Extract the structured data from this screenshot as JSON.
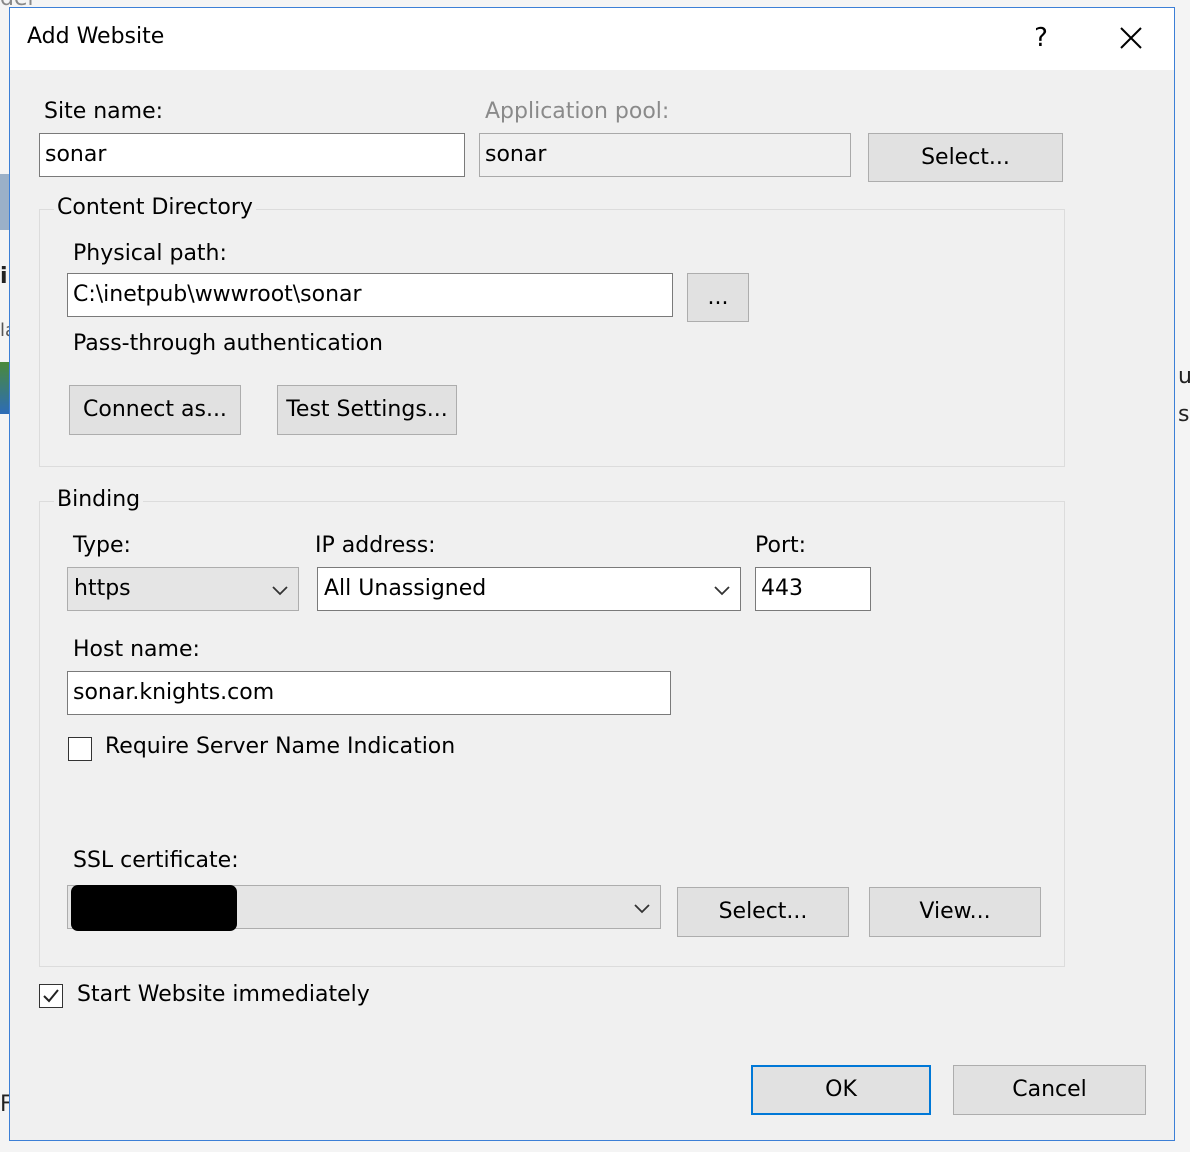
{
  "background": {
    "fragments": [
      "der",
      "il",
      "la",
      "u",
      "s",
      "F"
    ]
  },
  "dialog": {
    "title": "Add Website",
    "help_icon": "?",
    "close_icon": "close-icon"
  },
  "site": {
    "site_name_label": "Site name:",
    "site_name_value": "sonar",
    "app_pool_label": "Application pool:",
    "app_pool_value": "sonar",
    "select_button": "Select..."
  },
  "content_directory": {
    "title": "Content Directory",
    "physical_path_label": "Physical path:",
    "physical_path_value": "C:\\inetpub\\wwwroot\\sonar",
    "browse_button": "...",
    "pass_through_label": "Pass-through authentication",
    "connect_as_button": "Connect as...",
    "test_settings_button": "Test Settings..."
  },
  "binding": {
    "title": "Binding",
    "type_label": "Type:",
    "type_value": "https",
    "ip_label": "IP address:",
    "ip_value": "All Unassigned",
    "port_label": "Port:",
    "port_value": "443",
    "host_label": "Host name:",
    "host_value": "sonar.knights.com",
    "sni_label": "Require Server Name Indication",
    "sni_checked": false,
    "ssl_label": "SSL certificate:",
    "ssl_select_button": "Select...",
    "ssl_view_button": "View..."
  },
  "start_immediately": {
    "label": "Start Website immediately",
    "checked": true
  },
  "footer": {
    "ok_button": "OK",
    "cancel_button": "Cancel"
  },
  "colors": {
    "accent": "#0078d7",
    "dialog_border": "#3c7fd6",
    "window_bg": "#f0f0f0"
  }
}
